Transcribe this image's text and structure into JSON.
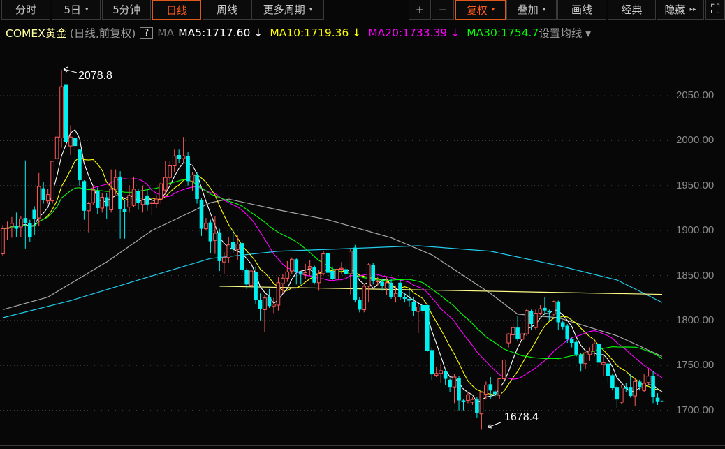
{
  "toolbar": {
    "left": [
      {
        "label": "分时"
      },
      {
        "label": "5日",
        "caret": "▾"
      },
      {
        "label": "5分钟"
      },
      {
        "label": "日线",
        "active": true
      },
      {
        "label": "周线"
      },
      {
        "label": "更多周期",
        "caret": "▾"
      }
    ],
    "right": [
      {
        "label": "+"
      },
      {
        "label": "−"
      },
      {
        "label": "复权",
        "caret": "▾",
        "active": true
      },
      {
        "label": "叠加",
        "caret": "▾"
      },
      {
        "label": "画线"
      },
      {
        "label": "经典"
      },
      {
        "label": "隐藏",
        "caret": "▸▸"
      }
    ],
    "fullscreen_icon": "⛶"
  },
  "legend": {
    "symbol": "COMEX黄金",
    "mode": "(日线,前复权)",
    "help": "?",
    "ma": "MA",
    "ma5": "MA5:1717.60 ↓",
    "ma10": "MA10:1719.36 ↓",
    "ma20": "MA20:1733.39 ↓",
    "ma30": "MA30:1754.7",
    "settings": "设置均线 ▾"
  },
  "colors": {
    "up": "#ff5a5a",
    "down": "#00f0f0",
    "ma5": "#ffffff",
    "ma10": "#ffff00",
    "ma20": "#ff00ff",
    "ma30": "#00ff00",
    "ma_long1": "#a8a8a8",
    "ma_long2": "#22ccee",
    "flat": "#ffff88"
  },
  "chart_data": {
    "type": "candlestick",
    "y_ticks": [
      "2050.00",
      "2000.00",
      "1950.00",
      "1900.00",
      "1850.00",
      "1800.00",
      "1750.00",
      "1700.00"
    ],
    "ylim": [
      1660,
      2100
    ],
    "annotations": {
      "high": "2078.8",
      "low": "1678.4"
    },
    "ohlc": [
      [
        1874,
        1902,
        1906,
        1872
      ],
      [
        1903,
        1903,
        1910,
        1890
      ],
      [
        1905,
        1908,
        1915,
        1892
      ],
      [
        1905,
        1902,
        1920,
        1893
      ],
      [
        1904,
        1913,
        1916,
        1893
      ],
      [
        1914,
        1908,
        1978,
        1880
      ],
      [
        1908,
        1893,
        1912,
        1887
      ],
      [
        1923,
        1913,
        1927,
        1895
      ],
      [
        1914,
        1949,
        1964,
        1905
      ],
      [
        1947,
        1934,
        1954,
        1930
      ],
      [
        1933,
        1940,
        1946,
        1930
      ],
      [
        1933,
        1977,
        1977,
        1930
      ],
      [
        1980,
        2004,
        2010,
        1975
      ],
      [
        2003,
        2060,
        2078.8,
        1992
      ],
      [
        2062,
        1998,
        2070,
        1985
      ],
      [
        1994,
        2004,
        2017,
        1984
      ],
      [
        2003,
        1994,
        2004,
        1963
      ],
      [
        1990,
        1956,
        1990,
        1950
      ],
      [
        1955,
        1922,
        1956,
        1912
      ],
      [
        1922,
        1930,
        1932,
        1898
      ],
      [
        1931,
        1945,
        1950,
        1929
      ],
      [
        1944,
        1925,
        1948,
        1918
      ],
      [
        1925,
        1937,
        1942,
        1920
      ],
      [
        1937,
        1927,
        1942,
        1913
      ],
      [
        1923,
        1946,
        1968,
        1920
      ],
      [
        1946,
        1959,
        1968,
        1940
      ],
      [
        1960,
        1924,
        1966,
        1891
      ],
      [
        1924,
        1921,
        1934,
        1891
      ],
      [
        1926,
        1939,
        1950,
        1920
      ],
      [
        1928,
        1946,
        1960,
        1926
      ],
      [
        1944,
        1931,
        1946,
        1923
      ],
      [
        1929,
        1934,
        1950,
        1920
      ],
      [
        1939,
        1929,
        1946,
        1922
      ],
      [
        1930,
        1931,
        1934,
        1917
      ],
      [
        1930,
        1935,
        1940,
        1925
      ],
      [
        1935,
        1952,
        1954,
        1930
      ],
      [
        1945,
        1959,
        1977,
        1940
      ],
      [
        1959,
        1972,
        1977,
        1950
      ],
      [
        1972,
        1983,
        1990,
        1965
      ],
      [
        1984,
        1980,
        1990,
        1975
      ],
      [
        1980,
        1983,
        2004,
        1976
      ],
      [
        1983,
        1955,
        1987,
        1950
      ],
      [
        1955,
        1962,
        1965,
        1944
      ],
      [
        1962,
        1935,
        1965,
        1930
      ],
      [
        1934,
        1902,
        1936,
        1894
      ],
      [
        1902,
        1908,
        1914,
        1900
      ],
      [
        1909,
        1888,
        1912,
        1875
      ],
      [
        1889,
        1897,
        1916,
        1874
      ],
      [
        1898,
        1866,
        1902,
        1855
      ],
      [
        1865,
        1870,
        1876,
        1852
      ],
      [
        1870,
        1884,
        1893,
        1864
      ],
      [
        1887,
        1879,
        1900,
        1875
      ],
      [
        1879,
        1885,
        1895,
        1867
      ],
      [
        1886,
        1856,
        1888,
        1853
      ],
      [
        1856,
        1840,
        1858,
        1835
      ],
      [
        1839,
        1855,
        1857,
        1833
      ],
      [
        1854,
        1823,
        1860,
        1818
      ],
      [
        1823,
        1813,
        1830,
        1800
      ],
      [
        1812,
        1825,
        1828,
        1787
      ],
      [
        1826,
        1816,
        1835,
        1814
      ],
      [
        1816,
        1818,
        1825,
        1808
      ],
      [
        1817,
        1842,
        1848,
        1811
      ],
      [
        1841,
        1847,
        1852,
        1830
      ],
      [
        1847,
        1854,
        1866,
        1843
      ],
      [
        1855,
        1868,
        1870,
        1852
      ],
      [
        1868,
        1854,
        1869,
        1840
      ],
      [
        1854,
        1851,
        1855,
        1840
      ],
      [
        1851,
        1853,
        1863,
        1846
      ],
      [
        1858,
        1860,
        1867,
        1850
      ],
      [
        1859,
        1842,
        1861,
        1840
      ],
      [
        1842,
        1852,
        1856,
        1833
      ],
      [
        1852,
        1874,
        1877,
        1850
      ],
      [
        1875,
        1853,
        1880,
        1850
      ],
      [
        1855,
        1846,
        1860,
        1845
      ],
      [
        1846,
        1857,
        1860,
        1841
      ],
      [
        1857,
        1858,
        1865,
        1852
      ],
      [
        1857,
        1852,
        1860,
        1848
      ],
      [
        1852,
        1877,
        1880,
        1829
      ],
      [
        1881,
        1823,
        1884,
        1820
      ],
      [
        1823,
        1812,
        1826,
        1809
      ],
      [
        1812,
        1838,
        1840,
        1809
      ],
      [
        1838,
        1862,
        1864,
        1820
      ],
      [
        1862,
        1844,
        1864,
        1840
      ],
      [
        1843,
        1844,
        1848,
        1838
      ],
      [
        1843,
        1838,
        1846,
        1833
      ],
      [
        1836,
        1842,
        1848,
        1828
      ],
      [
        1842,
        1826,
        1846,
        1824
      ],
      [
        1826,
        1830,
        1838,
        1820
      ],
      [
        1842,
        1826,
        1845,
        1823
      ],
      [
        1826,
        1824,
        1830,
        1820
      ],
      [
        1824,
        1822,
        1834,
        1815
      ],
      [
        1821,
        1810,
        1826,
        1805
      ],
      [
        1810,
        1815,
        1818,
        1786
      ],
      [
        1817,
        1810,
        1818,
        1808
      ],
      [
        1817,
        1766,
        1818,
        1765
      ],
      [
        1767,
        1740,
        1770,
        1734
      ],
      [
        1739,
        1741,
        1748,
        1737
      ],
      [
        1741,
        1744,
        1752,
        1730
      ],
      [
        1744,
        1735,
        1746,
        1728
      ],
      [
        1734,
        1726,
        1735,
        1720
      ],
      [
        1726,
        1737,
        1740,
        1708
      ],
      [
        1736,
        1711,
        1738,
        1700
      ],
      [
        1711,
        1709,
        1712,
        1700
      ],
      [
        1711,
        1717,
        1720,
        1708
      ],
      [
        1709,
        1712,
        1715,
        1706
      ],
      [
        1712,
        1697,
        1715,
        1692
      ],
      [
        1696,
        1720,
        1721,
        1678.4
      ],
      [
        1718,
        1728,
        1732,
        1712
      ],
      [
        1729,
        1722,
        1737,
        1713
      ],
      [
        1721,
        1718,
        1723,
        1715
      ],
      [
        1717,
        1735,
        1736,
        1713
      ],
      [
        1735,
        1756,
        1757,
        1733
      ],
      [
        1775,
        1785,
        1786,
        1770
      ],
      [
        1784,
        1792,
        1797,
        1780
      ],
      [
        1792,
        1779,
        1805,
        1777
      ],
      [
        1779,
        1785,
        1800,
        1772
      ],
      [
        1785,
        1811,
        1813,
        1783
      ],
      [
        1810,
        1796,
        1812,
        1789
      ],
      [
        1792,
        1808,
        1812,
        1790
      ],
      [
        1808,
        1813,
        1817,
        1806
      ],
      [
        1814,
        1811,
        1826,
        1806
      ],
      [
        1810,
        1809,
        1812,
        1800
      ],
      [
        1807,
        1821,
        1822,
        1805
      ],
      [
        1821,
        1798,
        1822,
        1789
      ],
      [
        1798,
        1793,
        1800,
        1790
      ],
      [
        1794,
        1779,
        1796,
        1775
      ],
      [
        1779,
        1775,
        1781,
        1770
      ],
      [
        1776,
        1762,
        1778,
        1760
      ],
      [
        1762,
        1752,
        1764,
        1743
      ],
      [
        1752,
        1764,
        1765,
        1746
      ],
      [
        1762,
        1766,
        1770,
        1755
      ],
      [
        1766,
        1774,
        1778,
        1760
      ],
      [
        1774,
        1753,
        1776,
        1750
      ],
      [
        1751,
        1753,
        1760,
        1738
      ],
      [
        1752,
        1738,
        1754,
        1730
      ],
      [
        1739,
        1725,
        1741,
        1722
      ],
      [
        1726,
        1712,
        1728,
        1702
      ],
      [
        1709,
        1725,
        1728,
        1707
      ],
      [
        1726,
        1724,
        1730,
        1720
      ],
      [
        1726,
        1716,
        1740,
        1714
      ],
      [
        1716,
        1732,
        1736,
        1705
      ],
      [
        1732,
        1726,
        1734,
        1722
      ],
      [
        1722,
        1730,
        1740,
        1720
      ],
      [
        1731,
        1738,
        1746,
        1729
      ],
      [
        1738,
        1715,
        1744,
        1708
      ],
      [
        1714,
        1710,
        1719,
        1706
      ],
      [
        1710,
        1709.5,
        1711,
        1709
      ]
    ],
    "ma_periods": [
      5,
      10,
      20,
      30
    ],
    "long_lines": [
      {
        "name": "ma-long-gray",
        "points": [
          [
            0,
            1812
          ],
          [
            10,
            1826
          ],
          [
            23,
            1865
          ],
          [
            33,
            1900
          ],
          [
            46,
            1931
          ],
          [
            50,
            1935
          ],
          [
            61,
            1923
          ],
          [
            72,
            1912
          ],
          [
            86,
            1892
          ],
          [
            95,
            1873
          ],
          [
            108,
            1830
          ],
          [
            114,
            1807
          ],
          [
            123,
            1803
          ],
          [
            136,
            1783
          ],
          [
            146,
            1760
          ]
        ]
      },
      {
        "name": "ma-long-cyan",
        "points": [
          [
            0,
            1803
          ],
          [
            15,
            1822
          ],
          [
            30,
            1845
          ],
          [
            46,
            1869
          ],
          [
            61,
            1877
          ],
          [
            77,
            1880
          ],
          [
            92,
            1883
          ],
          [
            108,
            1877
          ],
          [
            123,
            1861
          ],
          [
            136,
            1845
          ],
          [
            146,
            1820
          ]
        ]
      },
      {
        "name": "flat-line",
        "points": [
          [
            48,
            1838
          ],
          [
            146,
            1829
          ]
        ]
      }
    ]
  }
}
